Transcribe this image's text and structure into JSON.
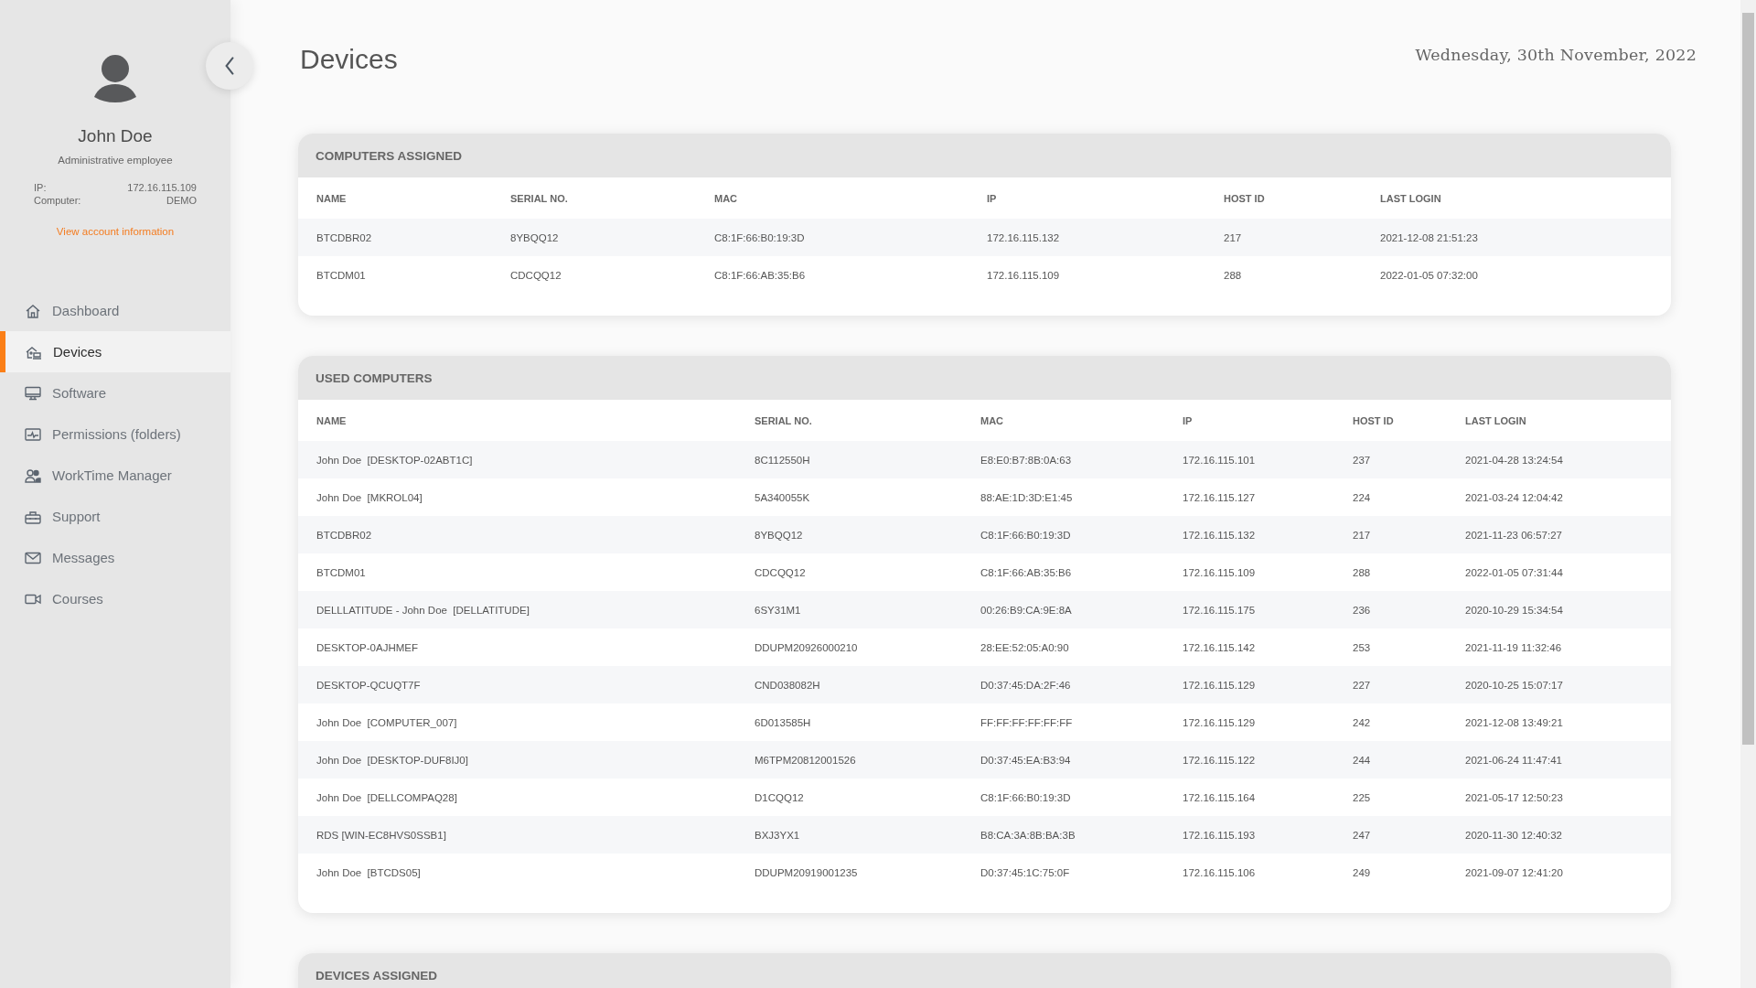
{
  "sidebar": {
    "user": {
      "name": "John Doe",
      "role": "Administrative employee",
      "info": [
        {
          "label": "IP:",
          "value": "172.16.115.109"
        },
        {
          "label": "Computer:",
          "value": "DEMO"
        }
      ],
      "link": "View account information"
    },
    "items": [
      {
        "label": "Dashboard",
        "selected": false
      },
      {
        "label": "Devices",
        "selected": true
      },
      {
        "label": "Software",
        "selected": false
      },
      {
        "label": "Permissions (folders)",
        "selected": false
      },
      {
        "label": "WorkTime Manager",
        "selected": false
      },
      {
        "label": "Support",
        "selected": false
      },
      {
        "label": "Messages",
        "selected": false
      },
      {
        "label": "Courses",
        "selected": false
      }
    ]
  },
  "header": {
    "title": "Devices",
    "date": "Wednesday, 30th November, 2022"
  },
  "sections": [
    {
      "title": "COMPUTERS ASSIGNED",
      "columns": [
        "NAME",
        "SERIAL NO.",
        "MAC",
        "IP",
        "HOST ID",
        "LAST LOGIN"
      ],
      "rows": [
        [
          "BTCDBR02",
          "8YBQQ12",
          "C8:1F:66:B0:19:3D",
          "172.16.115.132",
          "217",
          "2021-12-08 21:51:23"
        ],
        [
          "BTCDM01",
          "CDCQQ12",
          "C8:1F:66:AB:35:B6",
          "172.16.115.109",
          "288",
          "2022-01-05 07:32:00"
        ]
      ]
    },
    {
      "title": "USED COMPUTERS",
      "columns": [
        "NAME",
        "SERIAL NO.",
        "MAC",
        "IP",
        "HOST ID",
        "LAST LOGIN"
      ],
      "rows": [
        [
          "John Doe  [DESKTOP-02ABT1C]",
          "8C112550H",
          "E8:E0:B7:8B:0A:63",
          "172.16.115.101",
          "237",
          "2021-04-28 13:24:54"
        ],
        [
          "John Doe  [MKROL04]",
          "5A340055K",
          "88:AE:1D:3D:E1:45",
          "172.16.115.127",
          "224",
          "2021-03-24 12:04:42"
        ],
        [
          "BTCDBR02",
          "8YBQQ12",
          "C8:1F:66:B0:19:3D",
          "172.16.115.132",
          "217",
          "2021-11-23 06:57:27"
        ],
        [
          "BTCDM01",
          "CDCQQ12",
          "C8:1F:66:AB:35:B6",
          "172.16.115.109",
          "288",
          "2022-01-05 07:31:44"
        ],
        [
          "DELLLATITUDE - John Doe  [DELLATITUDE]",
          "6SY31M1",
          "00:26:B9:CA:9E:8A",
          "172.16.115.175",
          "236",
          "2020-10-29 15:34:54"
        ],
        [
          "DESKTOP-0AJHMEF",
          "DDUPM20926000210",
          "28:EE:52:05:A0:90",
          "172.16.115.142",
          "253",
          "2021-11-19 11:32:46"
        ],
        [
          "DESKTOP-QCUQT7F",
          "CND038082H",
          "D0:37:45:DA:2F:46",
          "172.16.115.129",
          "227",
          "2020-10-25 15:07:17"
        ],
        [
          "John Doe  [COMPUTER_007]",
          "6D013585H",
          "FF:FF:FF:FF:FF:FF",
          "172.16.115.129",
          "242",
          "2021-12-08 13:49:21"
        ],
        [
          "John Doe  [DESKTOP-DUF8IJ0]",
          "M6TPM20812001526",
          "D0:37:45:EA:B3:94",
          "172.16.115.122",
          "244",
          "2021-06-24 11:47:41"
        ],
        [
          "John Doe  [DELLCOMPAQ28]",
          "D1CQQ12",
          "C8:1F:66:B0:19:3D",
          "172.16.115.164",
          "225",
          "2021-05-17 12:50:23"
        ],
        [
          "RDS [WIN-EC8HVS0SSB1]",
          "BXJ3YX1",
          "B8:CA:3A:8B:BA:3B",
          "172.16.115.193",
          "247",
          "2020-11-30 12:40:32"
        ],
        [
          "John Doe  [BTCDS05]",
          "DDUPM20919001235",
          "D0:37:45:1C:75:0F",
          "172.16.115.106",
          "249",
          "2021-09-07 12:41:20"
        ]
      ]
    },
    {
      "title": "DEVICES ASSIGNED"
    }
  ]
}
